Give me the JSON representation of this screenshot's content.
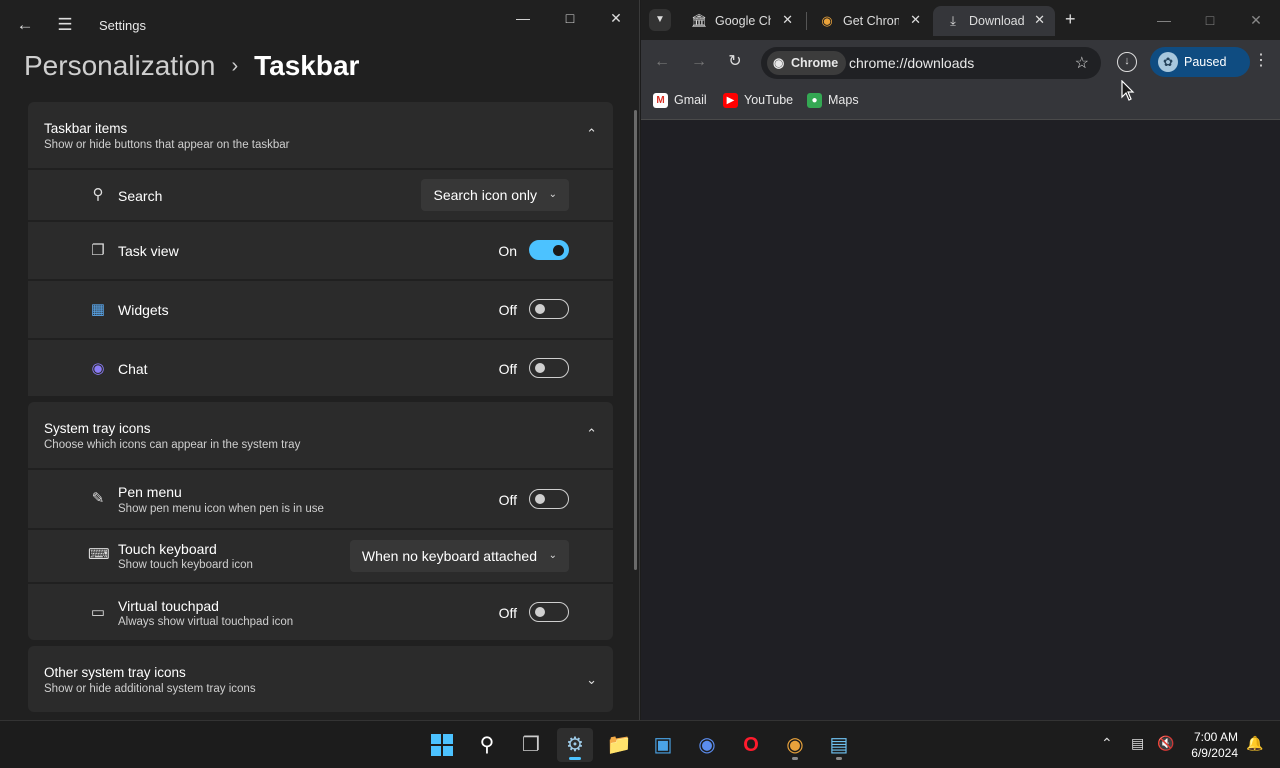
{
  "settings": {
    "app_title": "Settings",
    "breadcrumb": {
      "parent": "Personalization",
      "current": "Taskbar"
    },
    "taskbar_items": {
      "title": "Taskbar items",
      "subtitle": "Show or hide buttons that appear on the taskbar",
      "rows": [
        {
          "label": "Search",
          "control": "dropdown",
          "value": "Search icon only"
        },
        {
          "label": "Task view",
          "control": "toggle",
          "state": "On",
          "on": true
        },
        {
          "label": "Widgets",
          "control": "toggle",
          "state": "Off",
          "on": false
        },
        {
          "label": "Chat",
          "control": "toggle",
          "state": "Off",
          "on": false
        }
      ]
    },
    "system_tray_icons": {
      "title": "System tray icons",
      "subtitle": "Choose which icons can appear in the system tray",
      "rows": [
        {
          "label": "Pen menu",
          "sub": "Show pen menu icon when pen is in use",
          "control": "toggle",
          "state": "Off",
          "on": false
        },
        {
          "label": "Touch keyboard",
          "sub": "Show touch keyboard icon",
          "control": "dropdown",
          "value": "When no keyboard attached"
        },
        {
          "label": "Virtual touchpad",
          "sub": "Always show virtual touchpad icon",
          "control": "toggle",
          "state": "Off",
          "on": false
        }
      ]
    },
    "other_tray_icons": {
      "title": "Other system tray icons",
      "subtitle": "Show or hide additional system tray icons"
    }
  },
  "chrome": {
    "tabs": [
      {
        "title": "Google Ch",
        "icon": "institution-icon"
      },
      {
        "title": "Get Chron",
        "icon": "chrome-icon"
      },
      {
        "title": "Download",
        "icon": "download-icon",
        "active": true
      }
    ],
    "chip_label": "Chrome",
    "url": "chrome://downloads",
    "profile_label": "Paused",
    "bookmarks": [
      "Gmail",
      "YouTube",
      "Maps"
    ],
    "colors": {
      "accent": "#4cc2ff",
      "profile_chip": "#0f4c81"
    }
  },
  "taskbar": {
    "apps": [
      "start-icon",
      "search-icon",
      "task-view-icon",
      "settings-icon",
      "file-explorer-icon",
      "store-icon",
      "chromium-icon",
      "opera-icon",
      "chrome-icon",
      "notepad-icon"
    ],
    "time": "7:00 AM",
    "date": "6/9/2024"
  }
}
